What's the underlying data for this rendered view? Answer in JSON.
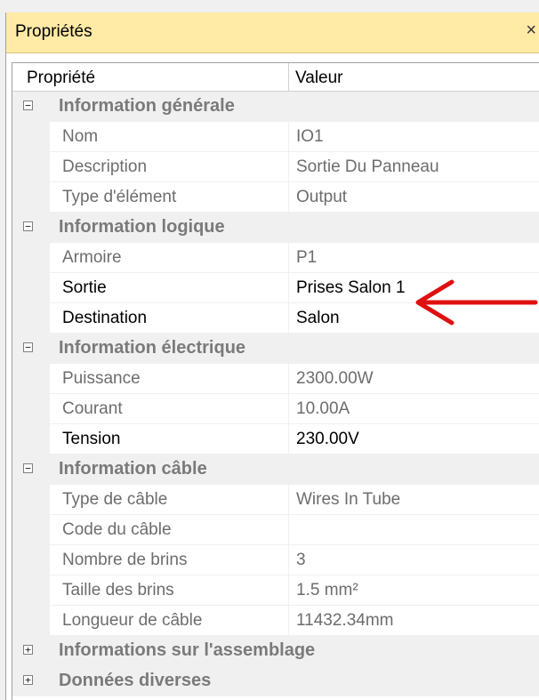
{
  "panel": {
    "title": "Propriétés",
    "close_label": "×"
  },
  "header": {
    "property_col": "Propriété",
    "value_col": "Valeur"
  },
  "categories": [
    {
      "label": "Information générale",
      "expanded": true,
      "toggle": "−",
      "rows": [
        {
          "name": "Nom",
          "value": "IO1",
          "readonly": true
        },
        {
          "name": "Description",
          "value": "Sortie Du Panneau",
          "readonly": true
        },
        {
          "name": "Type d'élément",
          "value": "Output",
          "readonly": true
        }
      ]
    },
    {
      "label": "Information logique",
      "expanded": true,
      "toggle": "−",
      "rows": [
        {
          "name": "Armoire",
          "value": "P1",
          "readonly": true
        },
        {
          "name": "Sortie",
          "value": "Prises Salon 1",
          "readonly": false
        },
        {
          "name": "Destination",
          "value": "Salon",
          "readonly": false
        }
      ]
    },
    {
      "label": "Information électrique",
      "expanded": true,
      "toggle": "−",
      "rows": [
        {
          "name": "Puissance",
          "value": "2300.00W",
          "readonly": true
        },
        {
          "name": "Courant",
          "value": "10.00A",
          "readonly": true
        },
        {
          "name": "Tension",
          "value": "230.00V",
          "readonly": false
        }
      ]
    },
    {
      "label": "Information câble",
      "expanded": true,
      "toggle": "−",
      "rows": [
        {
          "name": "Type de câble",
          "value": "Wires In Tube",
          "readonly": true
        },
        {
          "name": "Code du câble",
          "value": "",
          "readonly": true
        },
        {
          "name": "Nombre de brins",
          "value": "3",
          "readonly": true
        },
        {
          "name": "Taille des brins",
          "value": "1.5 mm²",
          "readonly": true
        },
        {
          "name": "Longueur de câble",
          "value": "11432.34mm",
          "readonly": true
        }
      ]
    },
    {
      "label": "Informations sur l'assemblage",
      "expanded": false,
      "toggle": "+",
      "rows": []
    },
    {
      "label": "Données diverses",
      "expanded": false,
      "toggle": "+",
      "rows": []
    }
  ],
  "annotation": {
    "arrow_color": "#e01010",
    "points_to": "Sortie"
  },
  "colors": {
    "titlebar_bg": "#ffeaa6",
    "category_bg": "#f0f0f0",
    "category_text": "#7a7a7a",
    "readonly_text": "#6d6d6d"
  }
}
